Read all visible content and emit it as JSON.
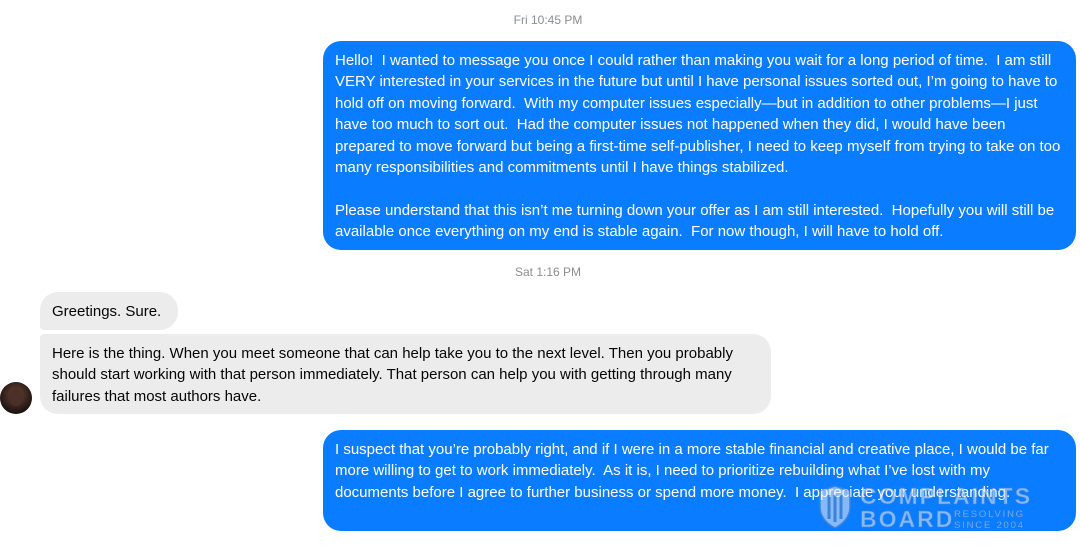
{
  "conversation": {
    "timestamp_1": "Fri 10:45 PM",
    "message_1": "Hello!  I wanted to message you once I could rather than making you wait for a long period of time.  I am still VERY interested in your services in the future but until I have personal issues sorted out, I’m going to have to hold off on moving forward.  With my computer issues especially—but in addition to other problems—I just have too much to sort out.  Had the computer issues not happened when they did, I would have been prepared to move forward but being a first-time self-publisher, I need to keep myself from trying to take on too many responsibilities and commitments until I have things stabilized.\n\nPlease understand that this isn’t me turning down your offer as I am still interested.  Hopefully you will still be available once everything on my end is stable again.  For now though, I will have to hold off.",
    "timestamp_2": "Sat 1:16 PM",
    "message_2": "Greetings. Sure.",
    "message_3": "Here is the thing. When you meet someone that can help take you to the next level. Then you probably should start working with that person immediately. That person can help you with getting through many failures that most authors have.",
    "message_4": "I suspect that you’re probably right, and if I were in a more stable financial and creative place, I would be far more willing to get to work immediately.  As it is, I need to prioritize rebuilding what I’ve lost with my documents before I agree to further business or spend more money.  I appreciate your understanding."
  },
  "watermark": {
    "line1": "COMPLAINTS",
    "line2": "BOARD",
    "tagline1": "RESOLVING",
    "tagline2": "SINCE 2004"
  },
  "colors": {
    "outgoing_bubble": "#0a7cff",
    "incoming_bubble": "#ececec",
    "timestamp_text": "#8a8d91"
  },
  "icons": {
    "avatar": "contact-avatar-photo",
    "watermark_logo": "shield-icon"
  }
}
